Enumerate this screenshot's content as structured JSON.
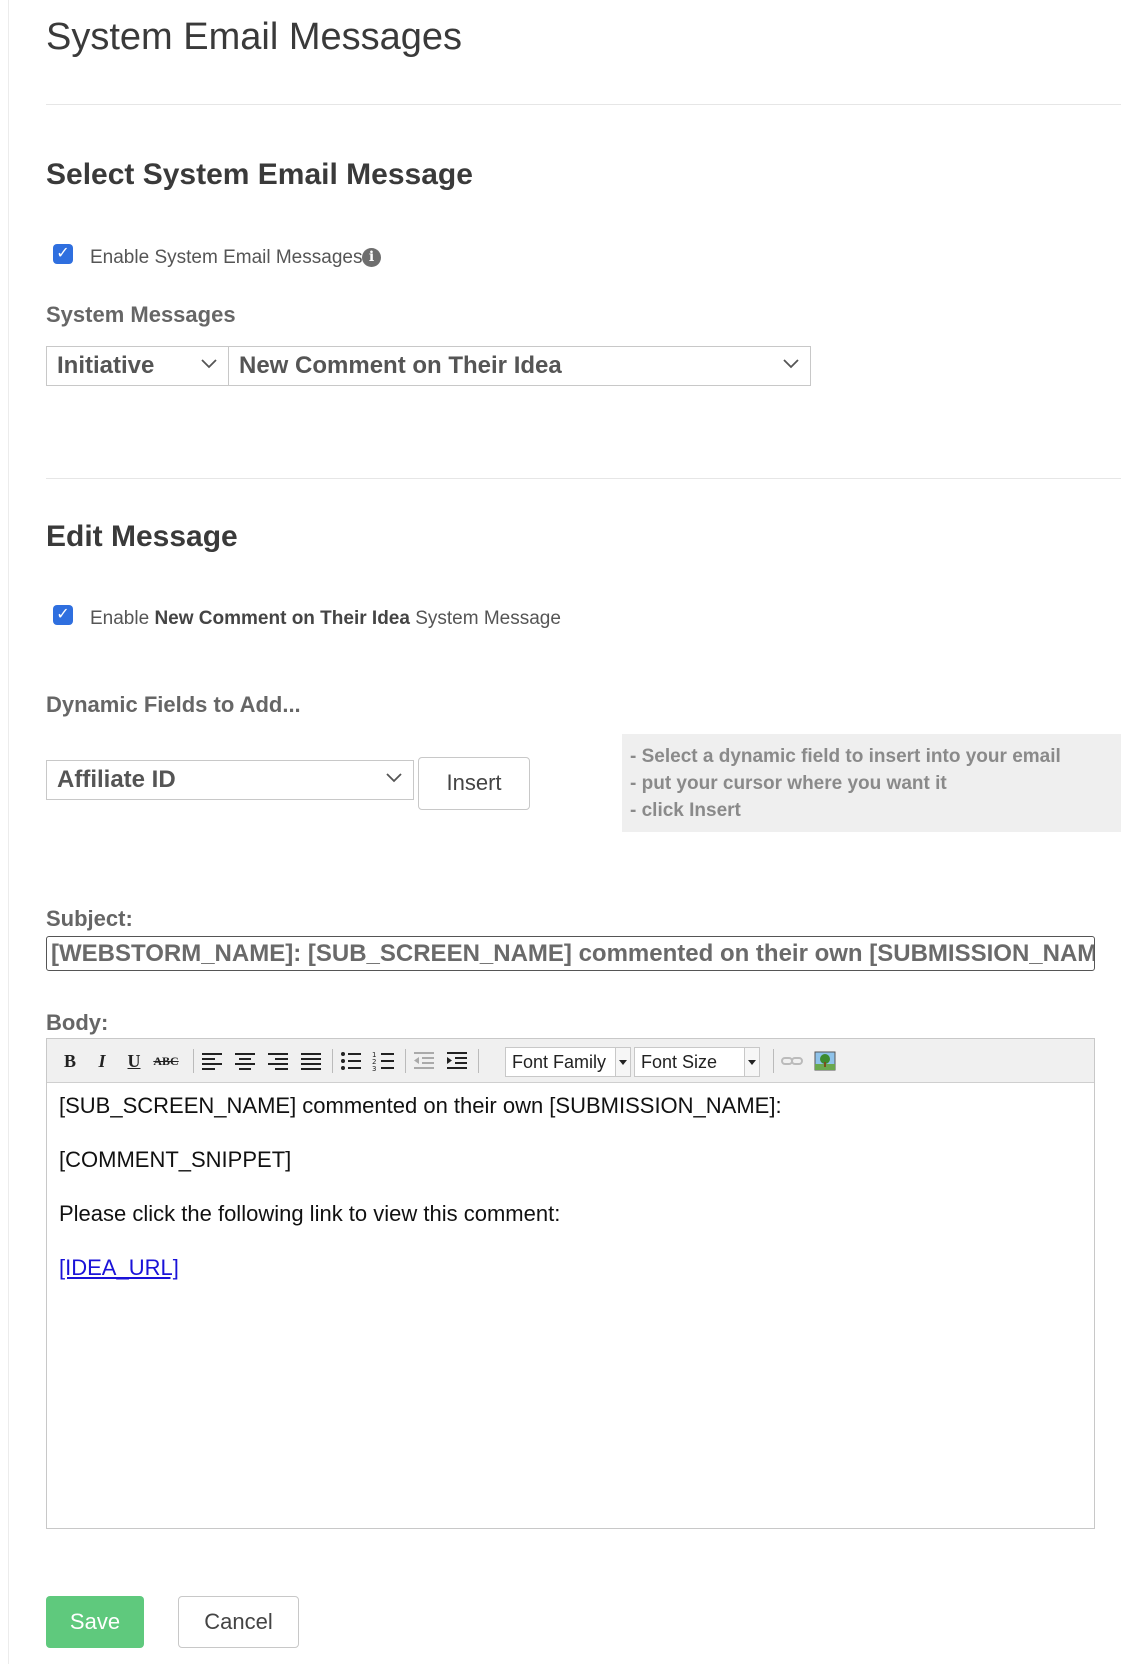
{
  "page": {
    "title": "System Email Messages"
  },
  "select_section": {
    "title": "Select System Email Message",
    "enable_checkbox": {
      "checked": true,
      "label": "Enable System Email Messages"
    },
    "system_messages_label": "System Messages",
    "category_select": {
      "value": "Initiative"
    },
    "message_select": {
      "value": "New Comment on Their Idea"
    }
  },
  "edit_section": {
    "title": "Edit Message",
    "enable_checkbox": {
      "checked": true,
      "label_prefix": "Enable",
      "label_bold": "New Comment on Their Idea",
      "label_suffix": "System Message"
    },
    "dynamic_fields_label": "Dynamic Fields to Add...",
    "dynamic_field_select": {
      "value": "Affiliate ID"
    },
    "insert_button": "Insert",
    "hint_lines": [
      "- Select a dynamic field to insert into your email",
      "- put your cursor where you want it",
      "- click Insert"
    ],
    "subject_label": "Subject:",
    "subject_value": "[WEBSTORM_NAME]: [SUB_SCREEN_NAME] commented on their own [SUBMISSION_NAME]...",
    "body_label": "Body:",
    "toolbar": {
      "bold": "B",
      "italic": "I",
      "underline": "U",
      "strikethrough": "ABC",
      "font_family": "Font Family",
      "font_size": "Font Size"
    },
    "body": {
      "line1": "[SUB_SCREEN_NAME] commented on their own [SUBMISSION_NAME]:",
      "line2": "[COMMENT_SNIPPET]",
      "line3": "Please click the following link to view this comment:",
      "link": "[IDEA_URL]"
    }
  },
  "actions": {
    "save": "Save",
    "cancel": "Cancel"
  },
  "colors": {
    "checkbox": "#2f6fdf",
    "save_button": "#5fc97d",
    "link": "#1a12d8",
    "hint_background": "#efefef"
  }
}
